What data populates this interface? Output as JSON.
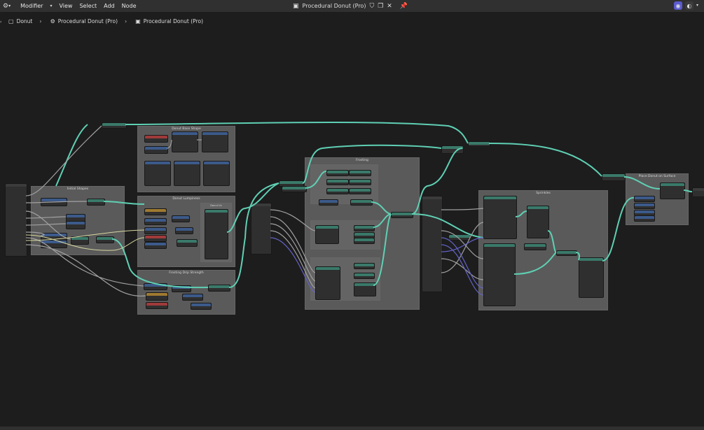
{
  "topbar": {
    "mode_icon": "node-editor-icon",
    "menu_modifier": "Modifier",
    "menu_view": "View",
    "menu_select": "Select",
    "menu_add": "Add",
    "menu_node": "Node",
    "tree_name": "Procedural Donut (Pro)"
  },
  "breadcrumb": {
    "object": "Donut",
    "modifier": "Procedural Donut (Pro)",
    "group": "Procedural Donut (Pro)"
  },
  "frames": {
    "initial_shapes": "Initial Shapes",
    "donut_base_shape": "Donut Base Shape",
    "donut_lumpiness": "Donut Lumpiness",
    "donut_uv": "Donut Uv",
    "frosting_drip_strength": "Frosting Drip Strength",
    "frosting": "Frosting",
    "sprinkles": "Sprinkles",
    "place_donut_on_surface": "Place Donut on Surface"
  },
  "colors": {
    "geometry_link": "#5fd0b4",
    "float_link": "#a1a1a1",
    "vector_link": "#6363c7",
    "boolean_link": "#cca6d6",
    "frame_bg": "#5a5a5a",
    "editor_bg": "#1d1d1d",
    "header_bg": "#303030"
  }
}
